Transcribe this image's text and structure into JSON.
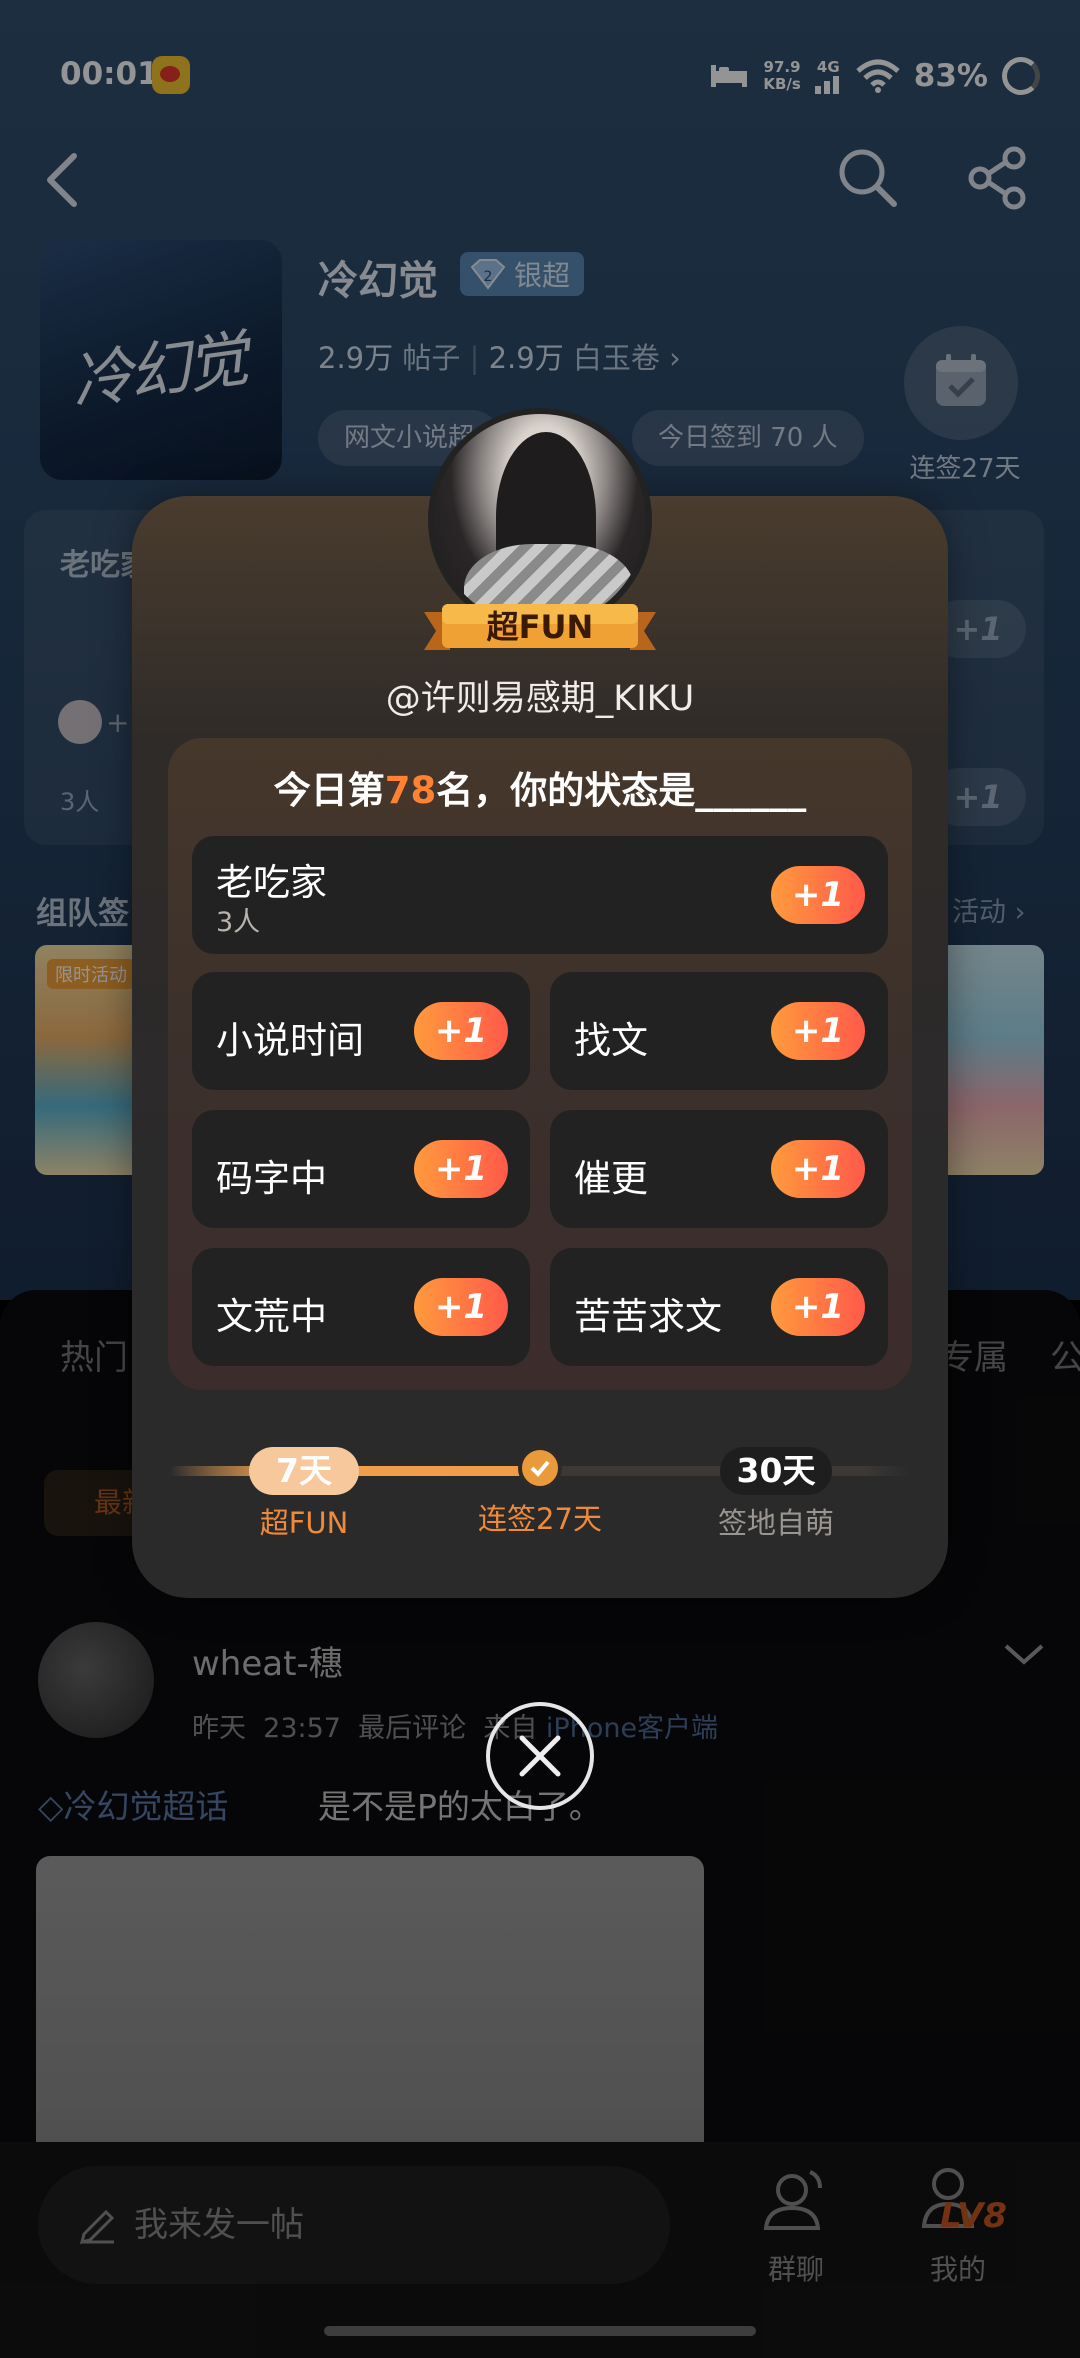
{
  "status_bar": {
    "time": "00:01",
    "net_speed_value": "97.9",
    "net_speed_unit": "KB/s",
    "network": "4G",
    "battery": "83%"
  },
  "topic": {
    "name": "冷幻觉",
    "cover_text": "冷幻觉",
    "badge": "银超",
    "badge_level": "2",
    "posts_count": "2.9万",
    "posts_label": "帖子",
    "jade_count": "2.9万",
    "jade_label": "白玉卷",
    "tags": [
      "网文小说超",
      "今日签到 70 人"
    ],
    "sign_streak": "连签27天"
  },
  "background": {
    "card_title": "老吃家",
    "card_count": "3人",
    "plus": "+1",
    "section_title": "组队签",
    "section_more": "活动",
    "thumb_badge": "限时活动",
    "tabs": [
      "热门",
      "专属",
      "公"
    ],
    "filter": "最新"
  },
  "modal": {
    "user_badge": "超FUN",
    "user_handle": "@许则易感期_KIKU",
    "title_prefix": "今日第",
    "rank": "78",
    "title_suffix": "名，你的状态是______",
    "options": [
      {
        "label": "老吃家",
        "count": "3人",
        "plus": "+1"
      },
      {
        "label": "小说时间",
        "plus": "+1"
      },
      {
        "label": "找文",
        "plus": "+1"
      },
      {
        "label": "码字中",
        "plus": "+1"
      },
      {
        "label": "催更",
        "plus": "+1"
      },
      {
        "label": "文荒中",
        "plus": "+1"
      },
      {
        "label": "苦苦求文",
        "plus": "+1"
      }
    ],
    "progress": {
      "milestones": [
        {
          "days": "7天",
          "label": "超FUN"
        },
        {
          "label": "连签27天"
        },
        {
          "days": "30天",
          "label": "签地自萌"
        }
      ],
      "current_days": 27,
      "total_days": 30
    }
  },
  "post": {
    "username": "wheat-穗",
    "day": "昨天",
    "time": "23:57",
    "meta": "最后评论",
    "source_prefix": "来自",
    "source": "iPhone客户端",
    "topic": "冷幻觉超话",
    "text": "是不是P的太白了。"
  },
  "bottom_bar": {
    "compose_placeholder": "我来发一帖",
    "group_chat": "群聊",
    "me": "我的",
    "level": "LV8"
  },
  "colors": {
    "accent_orange": "#ff8232",
    "plus_gradient_start": "#ff9a3c",
    "plus_gradient_end": "#ff5a4a",
    "modal_bg": "#2b2a2a",
    "topic_blue": "#5b79a8"
  }
}
